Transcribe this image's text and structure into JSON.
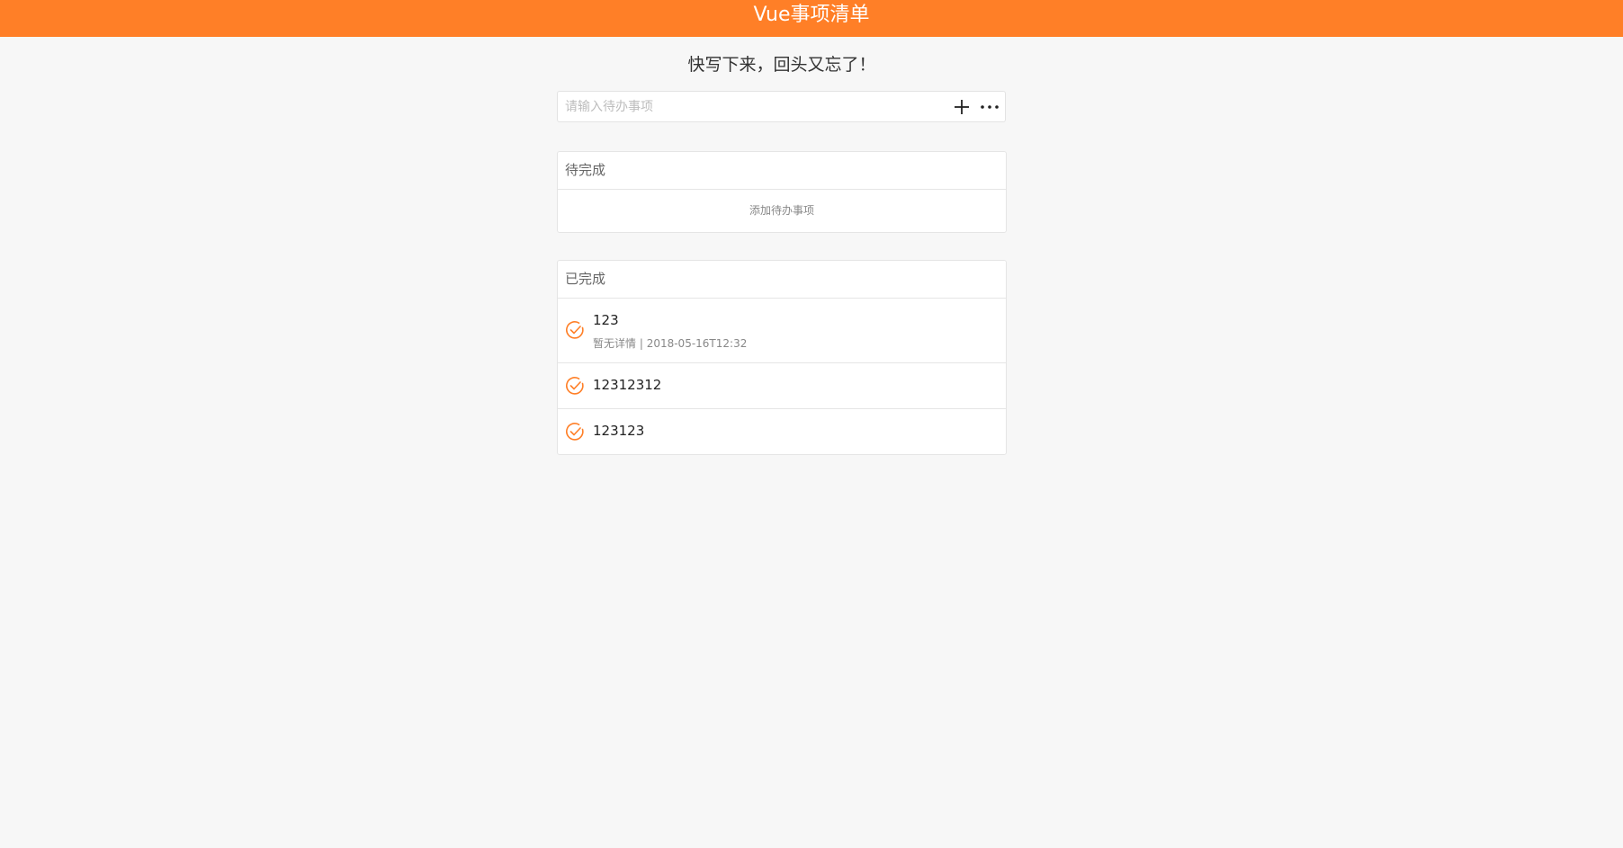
{
  "header": {
    "title": "Vue事项清单"
  },
  "slogan": "快写下来，回头又忘了！",
  "input": {
    "placeholder": "请输入待办事项",
    "value": ""
  },
  "icons": {
    "add": "plus-icon",
    "more": "more-dots-icon",
    "check": "check-circle-icon"
  },
  "colors": {
    "accent": "#ff7f27",
    "background": "#f7f7f7"
  },
  "pending": {
    "title": "待完成",
    "empty_hint": "添加待办事项"
  },
  "done": {
    "title": "已完成",
    "items": [
      {
        "title": "123",
        "detail": "暂无详情",
        "time": "2018-05-16T12:32"
      },
      {
        "title": "12312312"
      },
      {
        "title": "123123"
      }
    ]
  }
}
